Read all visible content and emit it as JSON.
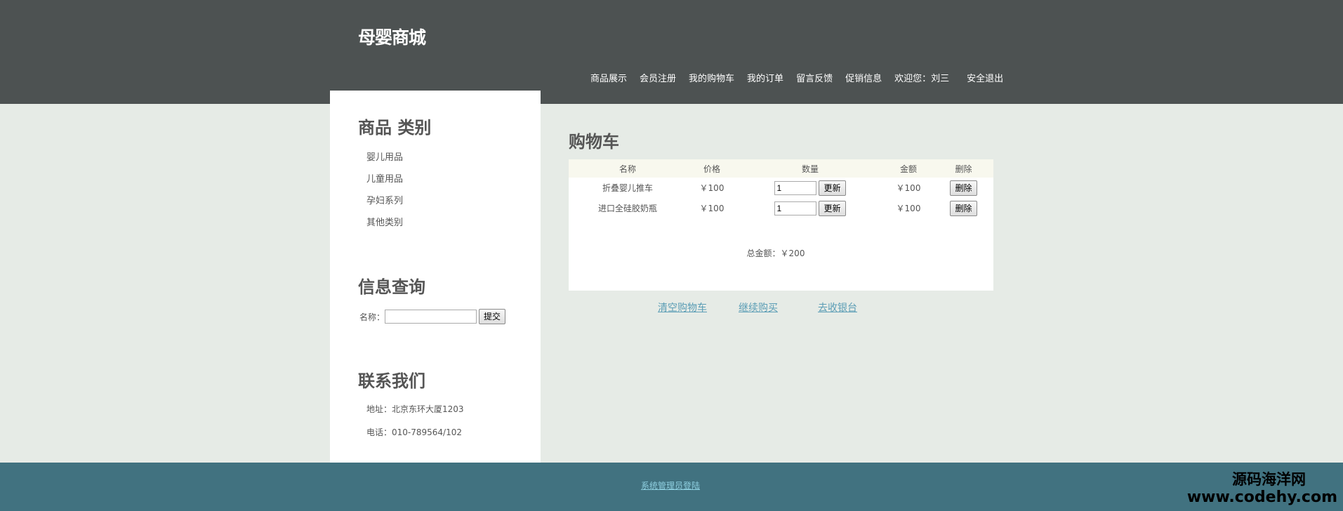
{
  "header": {
    "logo": "母婴商城",
    "nav": [
      "商品展示",
      "会员注册",
      "我的购物车",
      "我的订单",
      "留言反馈",
      "促销信息"
    ],
    "welcome": "欢迎您：刘三",
    "logout": "安全退出"
  },
  "sidebar": {
    "category_title": "商品 类别",
    "categories": [
      "婴儿用品",
      "儿童用品",
      "孕妇系列",
      "其他类别"
    ],
    "search_title": "信息查询",
    "search_label": "名称：",
    "search_value": "",
    "submit_label": "提交",
    "contact_title": "联系我们",
    "address": "地址：北京东环大厦1203",
    "phone": "电话：010-789564/102"
  },
  "cart": {
    "title": "购物车",
    "columns": [
      "名称",
      "价格",
      "数量",
      "金额",
      "删除"
    ],
    "rows": [
      {
        "name": "折叠婴儿推车",
        "price": "￥100",
        "qty": "1",
        "update": "更新",
        "amount": "￥100",
        "delete": "删除"
      },
      {
        "name": "进口全硅胶奶瓶",
        "price": "￥100",
        "qty": "1",
        "update": "更新",
        "amount": "￥100",
        "delete": "删除"
      }
    ],
    "total": "总金额：￥200",
    "clear": "清空购物车",
    "continue": "继续购买",
    "checkout": "去收银台"
  },
  "footer": {
    "admin_link": "系统管理员登陆",
    "watermark_cn": "源码海洋网",
    "watermark_url": "www.codehy.com"
  },
  "colors": {
    "header_bg": "#4d5252",
    "page_bg": "#e6ebe6",
    "footer_bg": "#417280",
    "link": "#5b9db5"
  }
}
